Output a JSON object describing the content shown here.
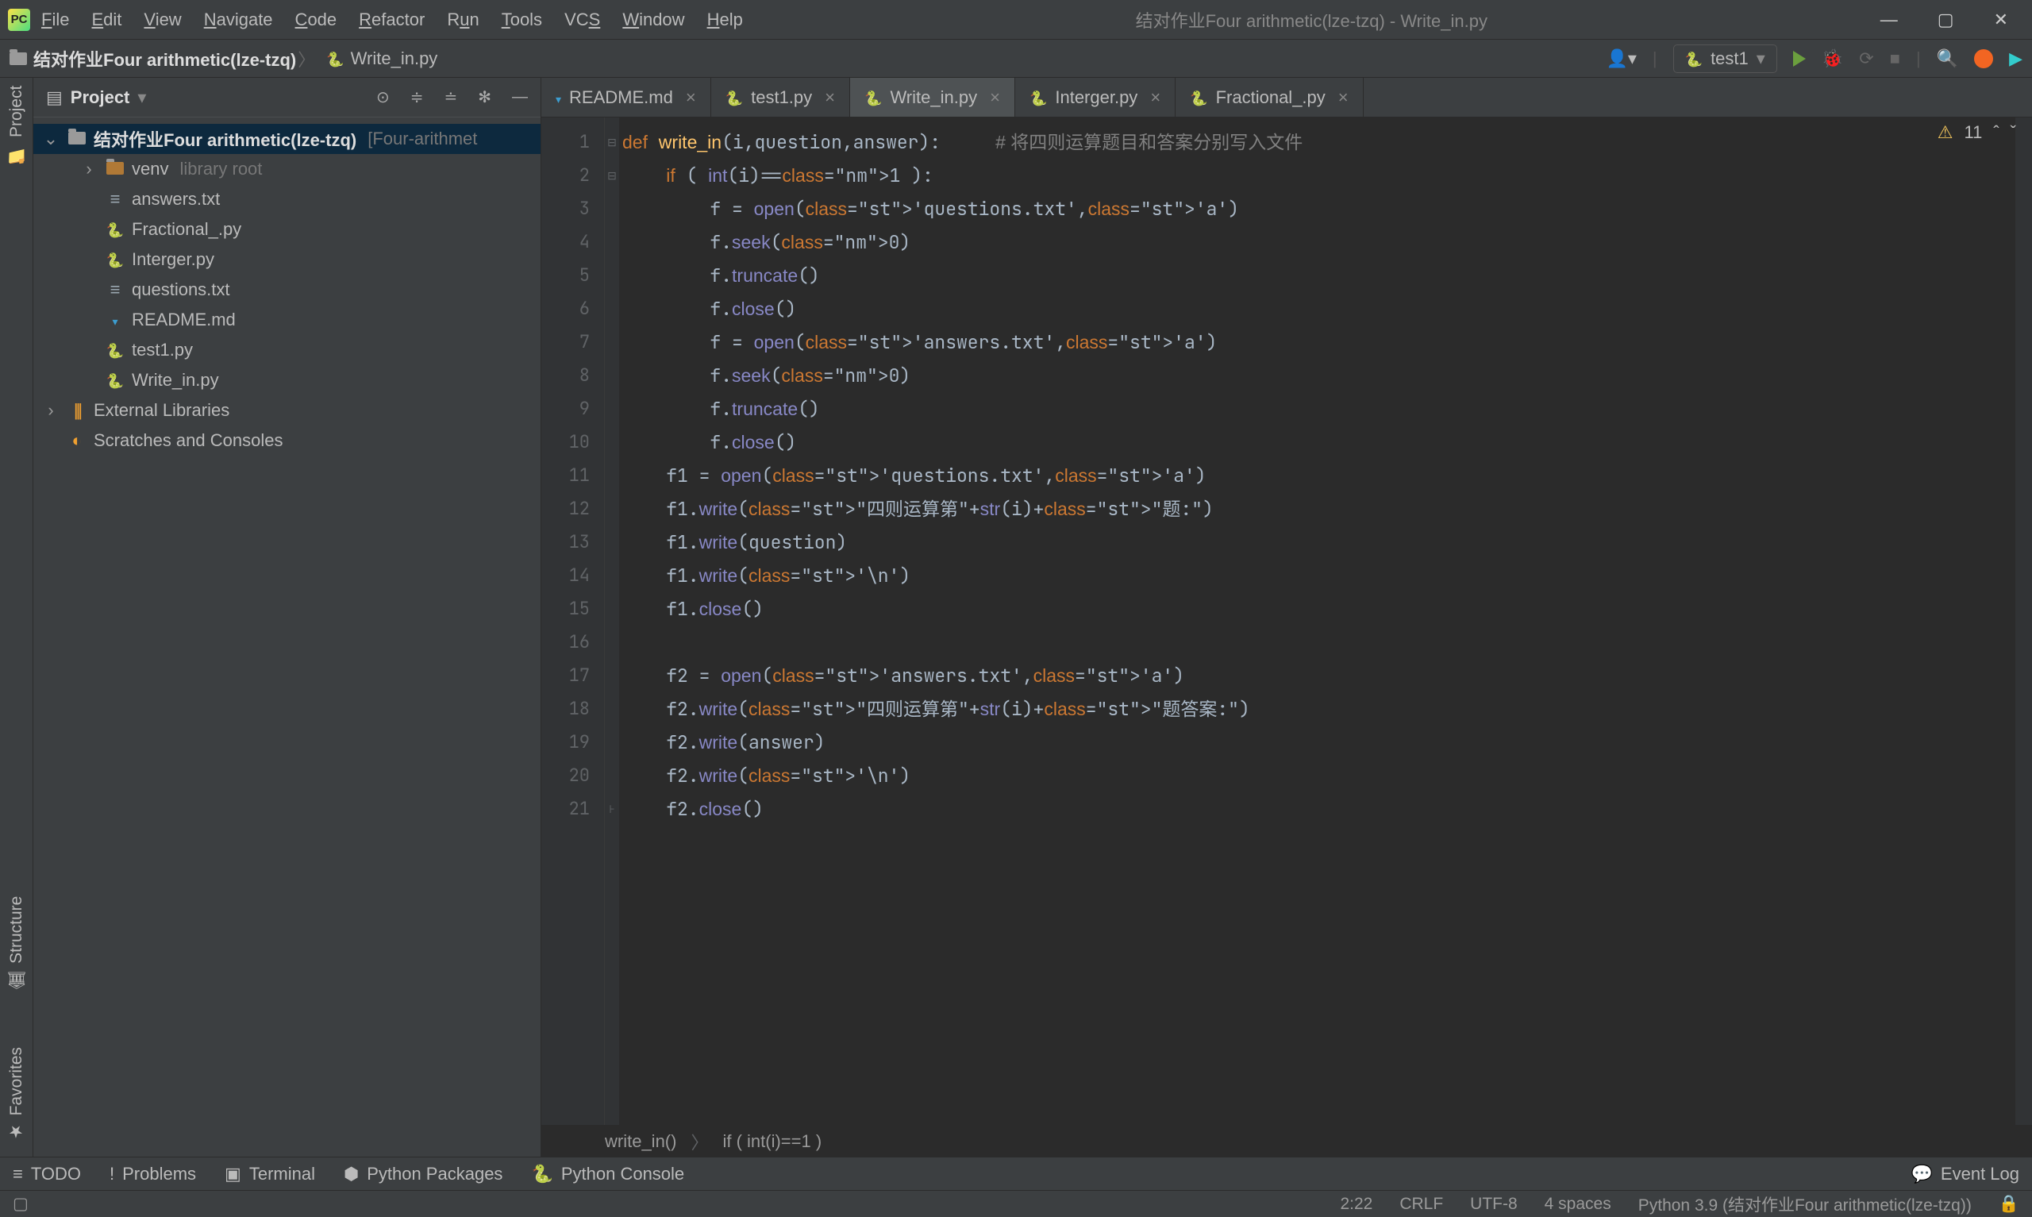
{
  "title": "结对作业Four arithmetic(lze-tzq) - Write_in.py",
  "menu": [
    "File",
    "Edit",
    "View",
    "Navigate",
    "Code",
    "Refactor",
    "Run",
    "Tools",
    "VCS",
    "Window",
    "Help"
  ],
  "menu_underline_idx": [
    0,
    0,
    0,
    0,
    0,
    0,
    1,
    0,
    2,
    0,
    0
  ],
  "breadcrumb": {
    "project": "结对作业Four arithmetic(lze-tzq)",
    "file": "Write_in.py"
  },
  "run_config": "test1",
  "project_panel": {
    "title": "Project",
    "root": {
      "name": "结对作业Four arithmetic(lze-tzq)",
      "suffix": "[Four-arithmet"
    },
    "venv": {
      "name": "venv",
      "suffix": "library root"
    },
    "files": [
      "answers.txt",
      "Fractional_.py",
      "Interger.py",
      "questions.txt",
      "README.md",
      "test1.py",
      "Write_in.py"
    ],
    "file_kinds": [
      "txt",
      "py",
      "py",
      "txt",
      "md",
      "py",
      "py"
    ],
    "external": "External Libraries",
    "scratches": "Scratches and Consoles"
  },
  "tabs": [
    {
      "label": "README.md",
      "kind": "md"
    },
    {
      "label": "test1.py",
      "kind": "py"
    },
    {
      "label": "Write_in.py",
      "kind": "py",
      "active": true
    },
    {
      "label": "Interger.py",
      "kind": "py"
    },
    {
      "label": "Fractional_.py",
      "kind": "py"
    }
  ],
  "warnings": "11",
  "code_lines": [
    "def write_in(i,question,answer):     # 将四则运算题目和答案分别写入文件",
    "    if ( int(i)==1 ):",
    "        f = open('questions.txt','a')",
    "        f.seek(0)",
    "        f.truncate()",
    "        f.close()",
    "        f = open('answers.txt','a')",
    "        f.seek(0)",
    "        f.truncate()",
    "        f.close()",
    "    f1 = open('questions.txt','a')",
    "    f1.write(\"四则运算第\"+str(i)+\"题:\")",
    "    f1.write(question)",
    "    f1.write('\\n')",
    "    f1.close()",
    "",
    "    f2 = open('answers.txt','a')",
    "    f2.write(\"四则运算第\"+str(i)+\"题答案:\")",
    "    f2.write(answer)",
    "    f2.write('\\n')",
    "    f2.close()"
  ],
  "code_crumb": [
    "write_in()",
    "if ( int(i)==1 )"
  ],
  "side_labels": {
    "project": "Project",
    "structure": "Structure",
    "favorites": "Favorites"
  },
  "bottom_tools": [
    "TODO",
    "Problems",
    "Terminal",
    "Python Packages",
    "Python Console"
  ],
  "bottom_icons": [
    "≡",
    "!",
    "▣",
    "⬢",
    "🐍"
  ],
  "event_log": "Event Log",
  "status": {
    "pos": "2:22",
    "le": "CRLF",
    "enc": "UTF-8",
    "indent": "4 spaces",
    "interp": "Python 3.9 (结对作业Four arithmetic(lze-tzq))"
  }
}
